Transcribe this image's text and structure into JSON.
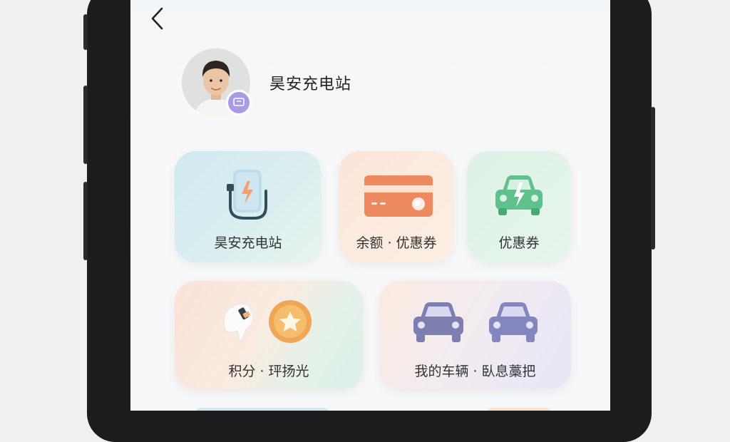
{
  "header": {
    "back_icon": "chevron-left-icon"
  },
  "profile": {
    "name": "昊安充电站",
    "badge_icon": "message-badge-icon"
  },
  "cards": [
    {
      "id": "station",
      "label": "昊安充电站",
      "icon": "charger-icon"
    },
    {
      "id": "balance",
      "label": "余额 ·  优惠券",
      "icon": "card-icon"
    },
    {
      "id": "coupon",
      "label": "优惠券",
      "icon": "ev-car-icon"
    },
    {
      "id": "points",
      "label": "积分 · 玶扬光",
      "icon": "points-icon"
    },
    {
      "id": "vehicles",
      "label": "我的车辆 · 臥息藁把",
      "icon": "car-icon"
    }
  ],
  "colors": {
    "accent_orange": "#ee8a5f",
    "accent_green": "#5fc28c",
    "accent_purple": "#7c7fb0",
    "badge_purple": "#a99be6"
  }
}
